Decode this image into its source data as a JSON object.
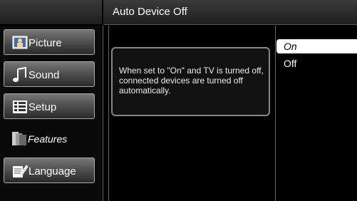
{
  "header": {
    "title": "Auto Device Off"
  },
  "sidebar": {
    "items": [
      {
        "label": "Picture",
        "icon": "picture-icon"
      },
      {
        "label": "Sound",
        "icon": "music-note-icon"
      },
      {
        "label": "Setup",
        "icon": "setup-grid-icon"
      },
      {
        "label": "Features",
        "icon": "features-stack-icon",
        "active": true
      },
      {
        "label": "Language",
        "icon": "language-icon"
      }
    ]
  },
  "description": "When set to \"On\" and TV is turned off, connected devices are turned off automatically.",
  "options": [
    {
      "label": "On",
      "selected": true
    },
    {
      "label": "Off",
      "selected": false
    }
  ],
  "colors": {
    "selected_bg": "#ffffff",
    "panel_border": "#888888",
    "menu_gradient_top": "#777777"
  }
}
